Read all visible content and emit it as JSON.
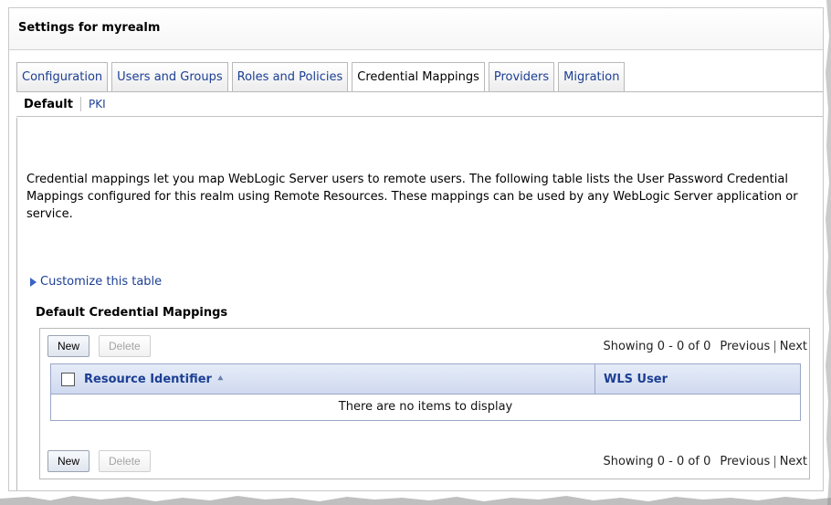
{
  "frame_title": "Settings for myrealm",
  "tabs": [
    {
      "label": "Configuration",
      "active": false
    },
    {
      "label": "Users and Groups",
      "active": false
    },
    {
      "label": "Roles and Policies",
      "active": false
    },
    {
      "label": "Credential Mappings",
      "active": true
    },
    {
      "label": "Providers",
      "active": false
    },
    {
      "label": "Migration",
      "active": false
    }
  ],
  "subtabs": {
    "active": "Default",
    "link": "PKI"
  },
  "description": "Credential mappings let you map WebLogic Server users to remote users. The following table lists the User Password Credential Mappings configured for this realm using Remote Resources. These mappings can be used by any WebLogic Server application or service.",
  "customize_link": "Customize this table",
  "table_title": "Default Credential Mappings",
  "toolbar": {
    "new_label": "New",
    "delete_label": "Delete",
    "showing": "Showing 0 - 0 of 0",
    "previous": "Previous",
    "separator": "|",
    "next": "Next"
  },
  "columns": {
    "resource": "Resource Identifier",
    "wls_user": "WLS User"
  },
  "empty_message": "There are no items to display",
  "icons": {
    "sort": "sort-ascending-icon",
    "expand": "expand-triangle-icon"
  },
  "colors": {
    "link": "#1c3f94",
    "header_bg": "#cfd9ef"
  }
}
